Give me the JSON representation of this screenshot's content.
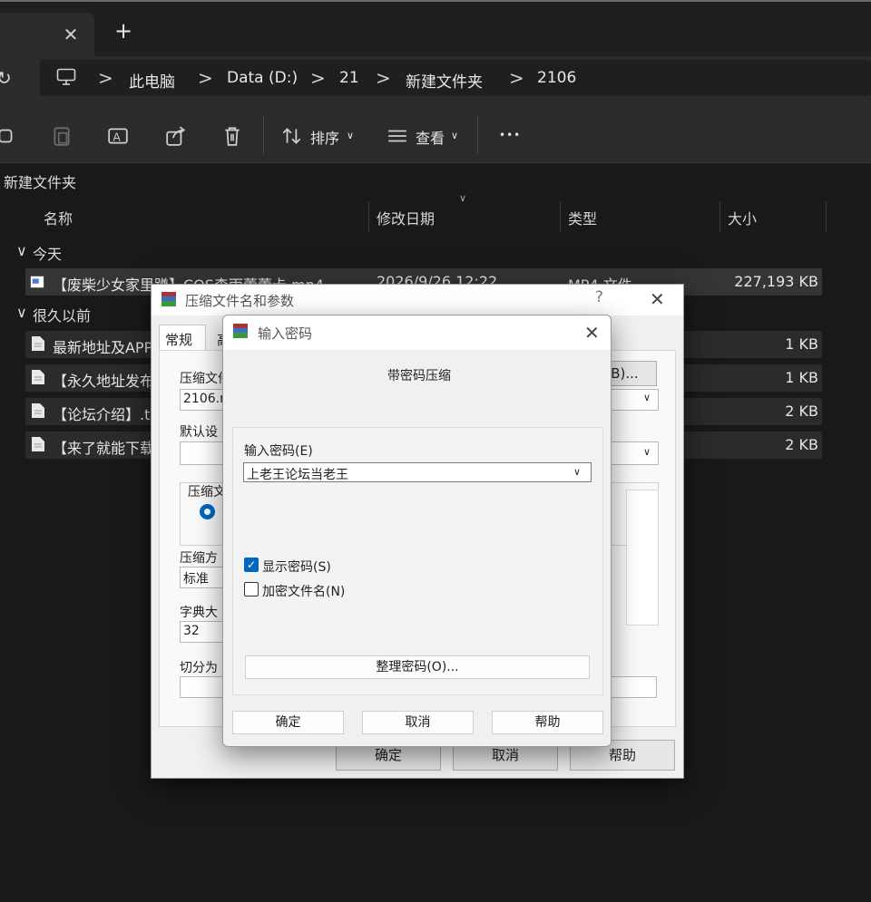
{
  "explorer": {
    "tab_close": "✕",
    "tab_new": "+",
    "breadcrumb": [
      "此电脑",
      "Data (D:)",
      "21",
      "新建文件夹",
      "2106"
    ],
    "breadcrumb_sep": ">",
    "toolbar": {
      "sort_label": "排序",
      "view_label": "查看",
      "more_label": "•••"
    },
    "location_label": "新建文件夹",
    "columns": {
      "name": "名称",
      "modified": "修改日期",
      "type": "类型",
      "size": "大小"
    },
    "groups": [
      {
        "label": "今天",
        "files": [
          {
            "name": "【废柴少女家里蹲】COS森雨蕾蕾卡.mp4",
            "modified": "2026/9/26 12:22",
            "type": "MP4 文件",
            "size": "227,193 KB"
          }
        ]
      },
      {
        "label": "很久以前",
        "files": [
          {
            "name": "最新地址及APP",
            "size": "1 KB"
          },
          {
            "name": "【永久地址发布",
            "size": "1 KB"
          },
          {
            "name": "【论坛介绍】.t",
            "size": "2 KB"
          },
          {
            "name": "【来了就能下载",
            "size": "2 KB"
          }
        ]
      }
    ]
  },
  "rar_dialog": {
    "title": "压缩文件名和参数",
    "help_q": "?",
    "close": "✕",
    "tabs": [
      "常规",
      "高"
    ],
    "archive_name_label": "压缩文件",
    "archive_name_value": "2106.r",
    "browse_label": "(B)...",
    "default_settings_label": "默认设",
    "format_label": "压缩文",
    "method_label": "压缩方",
    "method_value": "标准",
    "dict_label": "字典大",
    "dict_value": "32",
    "split_label": "切分为",
    "ok": "确定",
    "cancel": "取消",
    "help": "帮助"
  },
  "password_dialog": {
    "title": "输入密码",
    "close": "✕",
    "heading": "带密码压缩",
    "password_label": "输入密码(E)",
    "password_value": "上老王论坛当老王",
    "show_password_label": "显示密码(S)",
    "show_password_checked": true,
    "encrypt_names_label": "加密文件名(N)",
    "encrypt_names_checked": false,
    "organize_button": "整理密码(O)...",
    "ok": "确定",
    "cancel": "取消",
    "help": "帮助"
  }
}
